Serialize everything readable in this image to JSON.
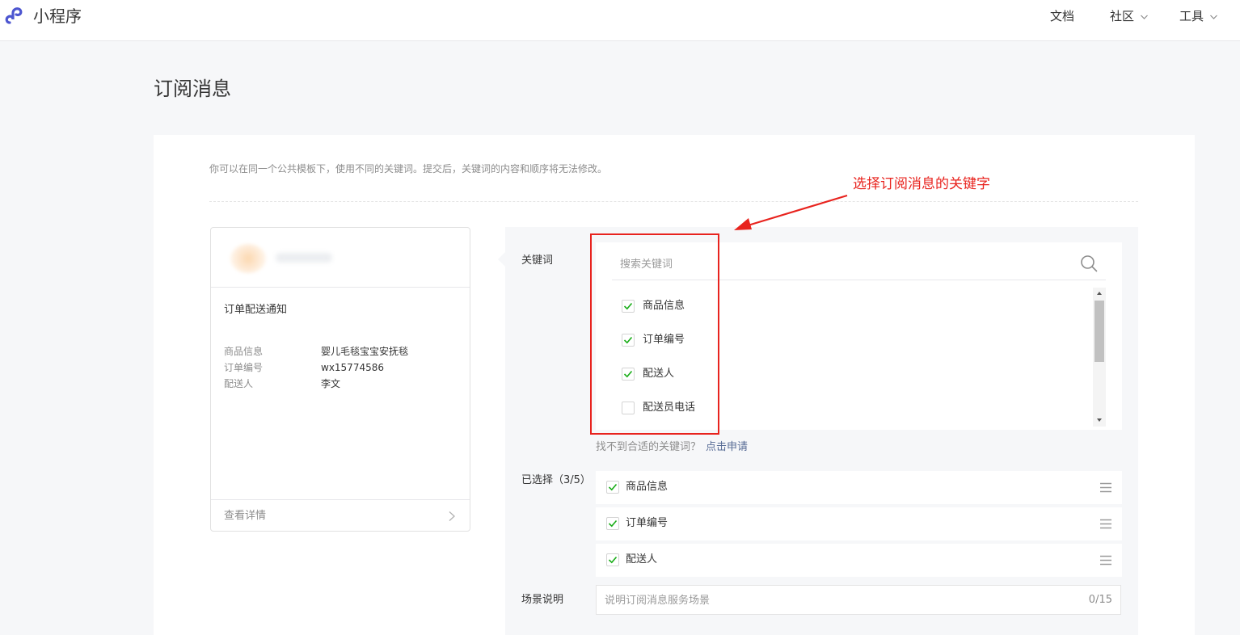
{
  "nav": {
    "brand": "小程序",
    "items": [
      {
        "label": "文档"
      },
      {
        "label": "社区"
      },
      {
        "label": "工具"
      }
    ]
  },
  "page": {
    "title": "订阅消息",
    "tip": "你可以在同一个公共模板下，使用不同的关键词。提交后，关键词的内容和顺序将无法修改。"
  },
  "preview": {
    "title": "订单配送通知",
    "rows": [
      {
        "key": "商品信息",
        "value": "婴儿毛毯宝宝安抚毯"
      },
      {
        "key": "订单编号",
        "value": "wx15774586"
      },
      {
        "key": "配送人",
        "value": "李文"
      }
    ],
    "footer_label": "查看详情"
  },
  "form": {
    "keyword_label": "关键词",
    "search_placeholder": "搜索关键词",
    "keywords": [
      {
        "label": "商品信息",
        "checked": true
      },
      {
        "label": "订单编号",
        "checked": true
      },
      {
        "label": "配送人",
        "checked": true
      },
      {
        "label": "配送员电话",
        "checked": false
      }
    ],
    "not_found_text": "找不到合适的关键词？",
    "apply_link": "点击申请",
    "selected_label": "已选择（3/5）",
    "selected": [
      {
        "label": "商品信息"
      },
      {
        "label": "订单编号"
      },
      {
        "label": "配送人"
      }
    ],
    "scene_label": "场景说明",
    "scene_placeholder": "说明订阅消息服务场景",
    "scene_counter": "0/15"
  },
  "annotation": {
    "text": "选择订阅消息的关键字",
    "color": "#e8231e"
  },
  "colors": {
    "accent_link": "#576b95",
    "check": "#1aad19",
    "brand": "#4d56d0"
  }
}
